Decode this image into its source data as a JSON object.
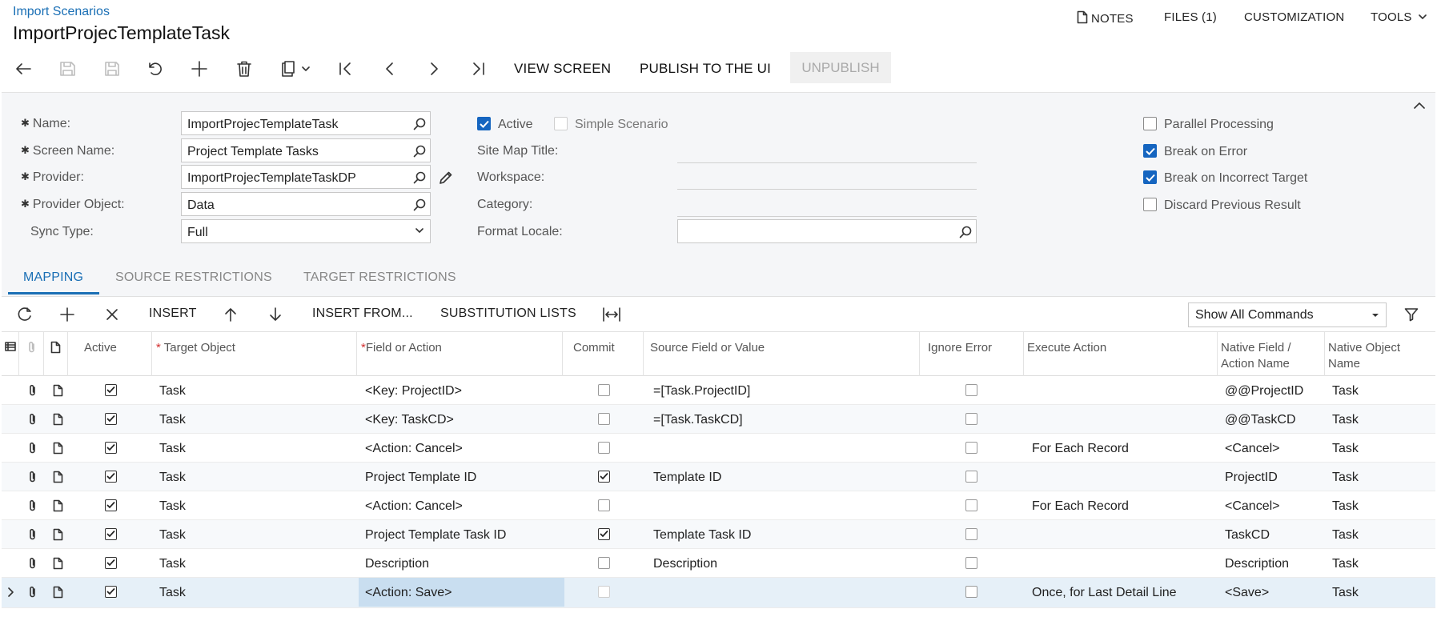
{
  "header": {
    "breadcrumb": "Import Scenarios",
    "title": "ImportProjecTemplateTask",
    "links": {
      "notes": "NOTES",
      "files": "FILES (1)",
      "customization": "CUSTOMIZATION",
      "tools": "TOOLS"
    }
  },
  "toolbar": {
    "view_screen": "VIEW SCREEN",
    "publish": "PUBLISH TO THE UI",
    "unpublish": "UNPUBLISH"
  },
  "form": {
    "name_label": "Name:",
    "name_value": "ImportProjecTemplateTask",
    "screen_label": "Screen Name:",
    "screen_value": "Project Template Tasks",
    "provider_label": "Provider:",
    "provider_value": "ImportProjecTemplateTaskDP",
    "provider_object_label": "Provider Object:",
    "provider_object_value": "Data",
    "sync_type_label": "Sync Type:",
    "sync_type_value": "Full",
    "active_label": "Active",
    "active_checked": true,
    "simple_label": "Simple Scenario",
    "simple_checked": false,
    "sitemap_label": "Site Map Title:",
    "sitemap_value": "",
    "workspace_label": "Workspace:",
    "workspace_value": "",
    "category_label": "Category:",
    "category_value": "",
    "format_locale_label": "Format Locale:",
    "format_locale_value": "",
    "parallel_label": "Parallel Processing",
    "parallel_checked": false,
    "break_error_label": "Break on Error",
    "break_error_checked": true,
    "break_target_label": "Break on Incorrect Target",
    "break_target_checked": true,
    "discard_label": "Discard Previous Result",
    "discard_checked": false
  },
  "tabs": {
    "mapping": "MAPPING",
    "source": "SOURCE RESTRICTIONS",
    "target": "TARGET RESTRICTIONS"
  },
  "grid_toolbar": {
    "insert": "INSERT",
    "insert_from": "INSERT FROM...",
    "substitution": "SUBSTITUTION LISTS",
    "command_filter": "Show All Commands"
  },
  "columns": {
    "active": "Active",
    "target_object": "Target Object",
    "field_action": "Field or Action",
    "commit": "Commit",
    "source_field": "Source Field or Value",
    "ignore_error": "Ignore Error",
    "execute_action": "Execute Action",
    "native_field_1": "Native Field /",
    "native_field_2": "Action Name",
    "native_object_1": "Native Object",
    "native_object_2": "Name"
  },
  "rows": [
    {
      "target": "Task",
      "field": "<Key: ProjectID>",
      "commit": false,
      "source": "=[Task.ProjectID]",
      "ignore": false,
      "execute": "",
      "native_field": "@@ProjectID",
      "native_object": "Task"
    },
    {
      "target": "Task",
      "field": "<Key: TaskCD>",
      "commit": false,
      "source": "=[Task.TaskCD]",
      "ignore": false,
      "execute": "",
      "native_field": "@@TaskCD",
      "native_object": "Task"
    },
    {
      "target": "Task",
      "field": "<Action: Cancel>",
      "commit": false,
      "source": "",
      "ignore": false,
      "execute": "For Each Record",
      "native_field": "<Cancel>",
      "native_object": "Task"
    },
    {
      "target": "Task",
      "field": "Project Template ID",
      "commit": true,
      "source": "Template ID",
      "ignore": false,
      "execute": "",
      "native_field": "ProjectID",
      "native_object": "Task"
    },
    {
      "target": "Task",
      "field": "<Action: Cancel>",
      "commit": false,
      "source": "",
      "ignore": false,
      "execute": "For Each Record",
      "native_field": "<Cancel>",
      "native_object": "Task"
    },
    {
      "target": "Task",
      "field": "Project Template Task ID",
      "commit": true,
      "source": "Template Task ID",
      "ignore": false,
      "execute": "",
      "native_field": "TaskCD",
      "native_object": "Task"
    },
    {
      "target": "Task",
      "field": "Description",
      "commit": false,
      "source": "Description",
      "ignore": false,
      "execute": "",
      "native_field": "Description",
      "native_object": "Task"
    },
    {
      "target": "Task",
      "field": "<Action: Save>",
      "commit": false,
      "source": "",
      "ignore": false,
      "execute": "Once, for Last Detail Line",
      "native_field": "<Save>",
      "native_object": "Task"
    }
  ]
}
